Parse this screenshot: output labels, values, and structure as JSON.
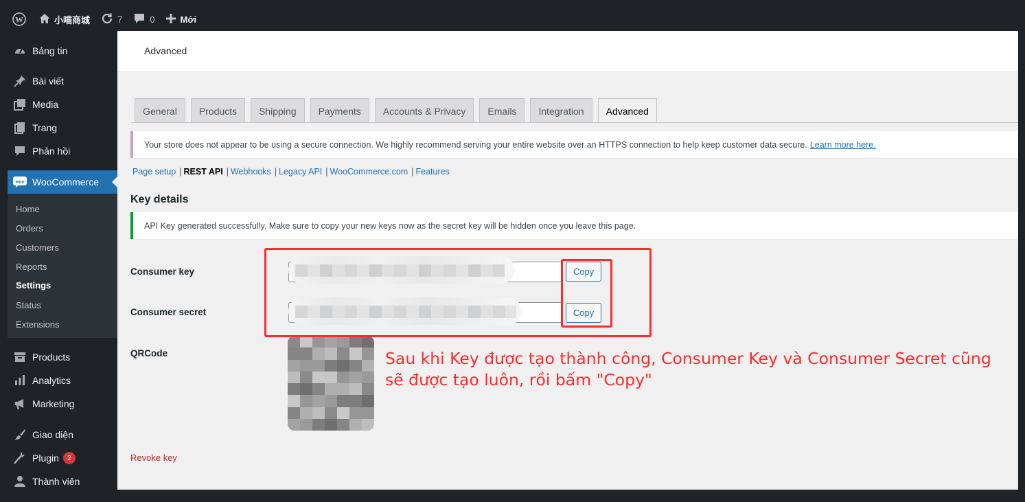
{
  "adminbar": {
    "site_name": "小喵商城",
    "updates_count": "7",
    "comments_count": "0",
    "new_label": "Mới"
  },
  "sidebar": {
    "items": [
      {
        "label": "Bảng tin",
        "icon": "dashboard-icon"
      },
      {
        "label": "Bài viết",
        "icon": "pin-icon"
      },
      {
        "label": "Media",
        "icon": "media-icon"
      },
      {
        "label": "Trang",
        "icon": "page-icon"
      },
      {
        "label": "Phản hồi",
        "icon": "comment-icon"
      },
      {
        "label": "WooCommerce",
        "icon": "woo-icon"
      },
      {
        "label": "Products",
        "icon": "archive-icon"
      },
      {
        "label": "Analytics",
        "icon": "bar-chart-icon"
      },
      {
        "label": "Marketing",
        "icon": "megaphone-icon"
      },
      {
        "label": "Giao diện",
        "icon": "brush-icon"
      },
      {
        "label": "Plugin",
        "icon": "plug-icon",
        "badge": "2"
      },
      {
        "label": "Thành viên",
        "icon": "user-icon"
      }
    ],
    "submenu": [
      "Home",
      "Orders",
      "Customers",
      "Reports",
      "Settings",
      "Status",
      "Extensions"
    ],
    "accent": "#2271b1"
  },
  "header": {
    "title": "Advanced"
  },
  "tabs": [
    "General",
    "Products",
    "Shipping",
    "Payments",
    "Accounts & Privacy",
    "Emails",
    "Integration",
    "Advanced"
  ],
  "notice": {
    "text": "Your store does not appear to be using a secure connection. We highly recommend serving your entire website over an HTTPS connection to help keep customer data secure.",
    "link": "Learn more here."
  },
  "sublinks": [
    "Page setup",
    "REST API",
    "Webhooks",
    "Legacy API",
    "WooCommerce.com",
    "Features"
  ],
  "section_title": "Key details",
  "success_notice": "API Key generated successfully. Make sure to copy your new keys now as the secret key will be hidden once you leave this page.",
  "form": {
    "consumer_key_label": "Consumer key",
    "consumer_secret_label": "Consumer secret",
    "qrcode_label": "QRCode",
    "copy_label": "Copy"
  },
  "revoke_label": "Revoke key",
  "annotation": {
    "text": "Sau khi Key được tạo thành công, Consumer Key và Consumer Secret cũng sẽ được tạo luôn, rồi bấm \"Copy\"",
    "color": "#ff2a2a"
  }
}
